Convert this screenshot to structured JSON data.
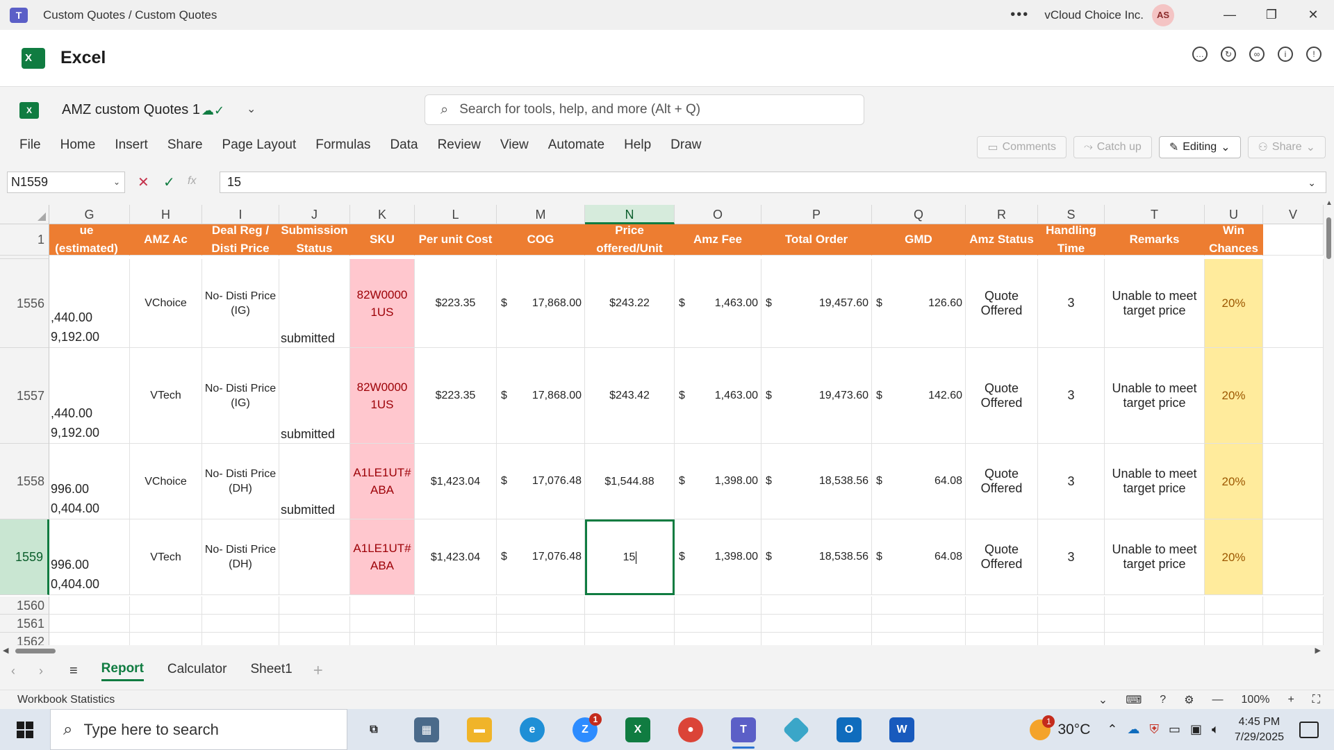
{
  "titlebar": {
    "title": "Custom Quotes / Custom Quotes",
    "org": "vCloud Choice Inc.",
    "avatar": "AS"
  },
  "app": {
    "name": "Excel"
  },
  "ribbon": {
    "doc_name": "AMZ custom Quotes 1",
    "search_placeholder": "Search for tools, help, and more (Alt + Q)",
    "menu": [
      "File",
      "Home",
      "Insert",
      "Share",
      "Page Layout",
      "Formulas",
      "Data",
      "Review",
      "View",
      "Automate",
      "Help",
      "Draw"
    ],
    "comments": "Comments",
    "catchup": "Catch up",
    "editing": "Editing",
    "share": "Share"
  },
  "formula": {
    "namebox": "N1559",
    "fx": "fx",
    "value": "15"
  },
  "columns": [
    "G",
    "H",
    "I",
    "J",
    "K",
    "L",
    "M",
    "N",
    "O",
    "P",
    "Q",
    "R",
    "S",
    "T",
    "U",
    "V"
  ],
  "header_row": {
    "row": "1",
    "G": "ue (estimated)",
    "H": "AMZ Ac",
    "I": "Deal Reg / Disti Price",
    "J": "Submission Status",
    "K": "SKU",
    "L": "Per unit Cost",
    "M": "COG",
    "N": "Price offered/Unit",
    "O": "Amz Fee",
    "P": "Total Order",
    "Q": "GMD",
    "R": "Amz Status",
    "S": "Handling Time",
    "T": "Remarks",
    "U": "Win Chances"
  },
  "rows": [
    {
      "row": "1556",
      "G1": ",440.00",
      "G2": "9,192.00",
      "H": "VChoice",
      "I": "No- Disti Price (IG)",
      "J": "submitted",
      "K": "82W0000 1US",
      "L": "$223.35",
      "M": "17,868.00",
      "N": "$243.22",
      "O": "1,463.00",
      "P": "19,457.60",
      "Q": "126.60",
      "R": "Quote Offered",
      "S": "3",
      "T": "Unable to meet target price",
      "U": "20%"
    },
    {
      "row": "1557",
      "G1": ",440.00",
      "G2": "9,192.00",
      "H": "VTech",
      "I": "No- Disti Price (IG)",
      "J": "submitted",
      "K": "82W0000 1US",
      "L": "$223.35",
      "M": "17,868.00",
      "N": "$243.42",
      "O": "1,463.00",
      "P": "19,473.60",
      "Q": "142.60",
      "R": "Quote Offered",
      "S": "3",
      "T": "Unable to meet target price",
      "U": "20%"
    },
    {
      "row": "1558",
      "G1": "996.00",
      "G2": "0,404.00",
      "H": "VChoice",
      "I": "No- Disti Price (DH)",
      "J": "submitted",
      "K": "A1LE1UT# ABA",
      "L": "$1,423.04",
      "M": "17,076.48",
      "N": "$1,544.88",
      "O": "1,398.00",
      "P": "18,538.56",
      "Q": "64.08",
      "R": "Quote Offered",
      "S": "3",
      "T": "Unable to meet target price",
      "U": "20%"
    },
    {
      "row": "1559",
      "G1": "996.00",
      "G2": "0,404.00",
      "H": "VTech",
      "I": "No- Disti Price (DH)",
      "J": "",
      "K": "A1LE1UT# ABA",
      "L": "$1,423.04",
      "M": "17,076.48",
      "N": "15",
      "O": "1,398.00",
      "P": "18,538.56",
      "Q": "64.08",
      "R": "Quote Offered",
      "S": "3",
      "T": "Unable to meet target price",
      "U": "20%"
    }
  ],
  "dollar": "$",
  "empty_rows": [
    "1560",
    "1561",
    "1562"
  ],
  "sheets": [
    "Report",
    "Calculator",
    "Sheet1"
  ],
  "status": {
    "left": "Workbook Statistics",
    "zoom": "100%"
  },
  "taskbar": {
    "search_placeholder": "Type here to search",
    "temp": "30°C",
    "weather_badge": "1",
    "zoom_badge": "1",
    "time": "4:45 PM",
    "date": "7/29/2025"
  }
}
